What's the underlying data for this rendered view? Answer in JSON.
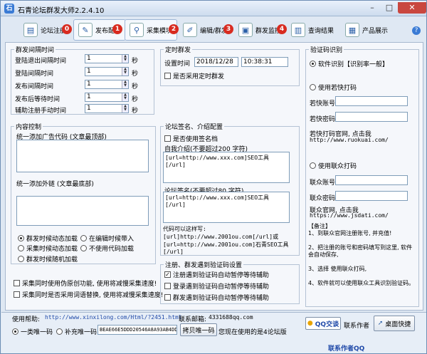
{
  "window": {
    "title": "石青论坛群发大师2.2.4.10"
  },
  "toolbar": {
    "tabs": [
      {
        "label": "论坛注册",
        "num": "0"
      },
      {
        "label": "发布配置",
        "num": "1"
      },
      {
        "label": "采集模块",
        "num": "2"
      },
      {
        "label": "编辑/群发",
        "num": "3"
      },
      {
        "label": "群发监控",
        "num": "4"
      },
      {
        "label": "查询结果",
        "num": ""
      },
      {
        "label": "产品展示",
        "num": ""
      }
    ],
    "help": "?"
  },
  "intervals": {
    "title": "群发间隔时间",
    "rows": [
      {
        "label": "登陆退出间隔时间",
        "value": "1",
        "unit": "秒"
      },
      {
        "label": "登陆间隔时间",
        "value": "1",
        "unit": "秒"
      },
      {
        "label": "发布间隔时间",
        "value": "1",
        "unit": "秒"
      },
      {
        "label": "发布后等待时间",
        "value": "1",
        "unit": "秒"
      },
      {
        "label": "辅助注册手动时间",
        "value": "1",
        "unit": "秒"
      }
    ]
  },
  "schedule": {
    "title": "定时群发",
    "time_label": "设置时间",
    "date": "2018/12/28",
    "time": "10:38:31",
    "enable_label": "是否采用定时群发"
  },
  "content": {
    "title": "内容控制",
    "ad_label": "统一添加广告代码 (文章最顶部)",
    "link_label": "统一添加外链 (文章最底部)",
    "radios": [
      {
        "label": "群发时候动态加载",
        "on": true
      },
      {
        "label": "在编辑时候带入",
        "on": false
      },
      {
        "label": "采集时候动态加载",
        "on": false
      },
      {
        "label": "不使用代码加载",
        "on": false
      },
      {
        "label": "群发时候随机加载",
        "on": false
      }
    ],
    "check1": "采集同时使用伪原创功能, 使用将减慢采集速度!",
    "check2": "采集同时是否采用词语替换, 使用将减慢采集速度!"
  },
  "signature": {
    "title": "论坛签名、介绍配置",
    "use_sig": "是否使用签名档",
    "intro_label": "自我介绍(不要超过200 字符)",
    "intro_value": "[url=http://www.xxx.com]SEO工具[/url]",
    "sig_label": "论坛签名(不要超过80 字符)",
    "sig_value": "[url=http://www.xxx.com]SEO工具[/url]",
    "hint": "代码可以这样写:\n[url]http://www.2001ou.com[/url]或\n[url=http://www.2001ou.com]石青SEO工具\n[/url]"
  },
  "captcha_cfg": {
    "title": "注册、群发遇到验证码设置",
    "items": [
      {
        "label": "注册遇到验证码自动暂停等待辅助",
        "checked": true
      },
      {
        "label": "登录遇到验证码自动暂停等待辅助",
        "checked": false
      },
      {
        "label": "群发遇到验证码自动暂停等待辅助",
        "checked": false
      }
    ]
  },
  "captcha": {
    "title": "验证码识别",
    "soft": "软件识别【识别率一般】",
    "ruokuai": "使用若快打码",
    "rk_user": "若快账号",
    "rk_pass": "若快密码",
    "rk_site": "若快打码官网, 点击我",
    "rk_url": "http://www.ruokuai.com/",
    "lianzhong": "使用联众打码",
    "lz_user": "联众账号",
    "lz_pass": "联众密码",
    "lz_site": "联众官网, 点击我",
    "lz_url": "https://www.jsdati.com/",
    "note": "【备注】\n1、到联众官网注册账号, 并充值!\n\n2、把注册的账号和密码填写到这里, 软件会自动保存,\n\n3、选择 使用联众打码,\n\n4、软件就可以使用联众工具识别验证码。"
  },
  "footer": {
    "help_label": "使用帮助:",
    "help_url": "http://www.xinxilong.com/Html/?2451.html",
    "mail_label": "联系邮箱:",
    "mail_value": "4331688qq.com",
    "radio1": "一类唯一码",
    "radio2": "补充唯一码",
    "code": "BEAE66E5DDD20546A8A93AB4DD",
    "copy_btn": "拷贝唯一码",
    "version_note": "您现在使用的是4论坛版",
    "qq_btn": "QQ交谈",
    "contact_btn": "联系作者",
    "shortcut_btn": "桌面快捷",
    "author": "联系作者QQ"
  }
}
